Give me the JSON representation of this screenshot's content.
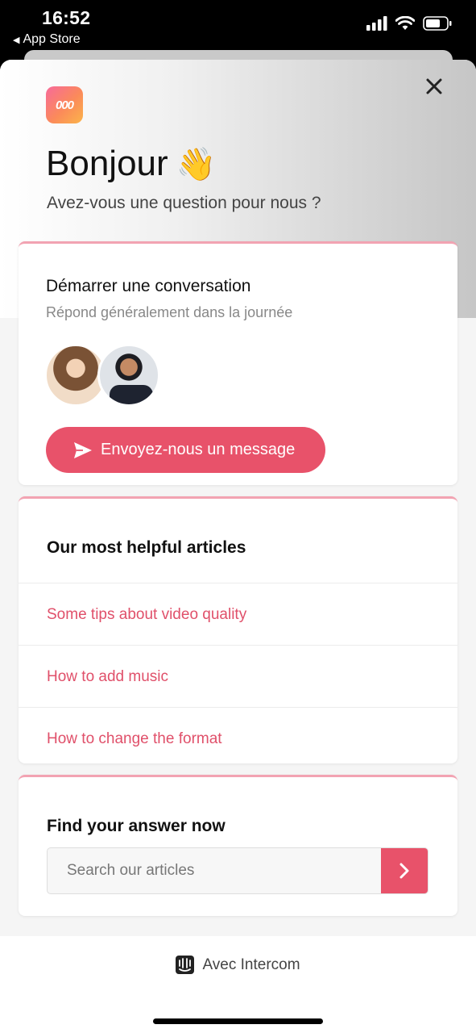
{
  "status_bar": {
    "time": "16:52",
    "back_label": "App Store",
    "icons": [
      "signal-icon",
      "wifi-icon",
      "battery-icon"
    ]
  },
  "header": {
    "logo_text": "000",
    "greeting": "Bonjour",
    "greeting_emoji": "👋",
    "subtitle": "Avez-vous une question pour nous ?"
  },
  "conversation_card": {
    "title": "Démarrer une conversation",
    "reply_time": "Répond généralement dans la journée",
    "button_label": "Envoyez-nous un message"
  },
  "articles_card": {
    "heading": "Our most helpful articles",
    "articles": [
      "Some tips about video quality",
      "How to add music",
      "How to change the format"
    ]
  },
  "search_card": {
    "heading": "Find your answer now",
    "placeholder": "Search our articles"
  },
  "footer": {
    "powered_by": "Avec Intercom"
  },
  "colors": {
    "accent": "#e8526a",
    "card_top_border": "#f2a3b2",
    "link": "#e0506a"
  }
}
